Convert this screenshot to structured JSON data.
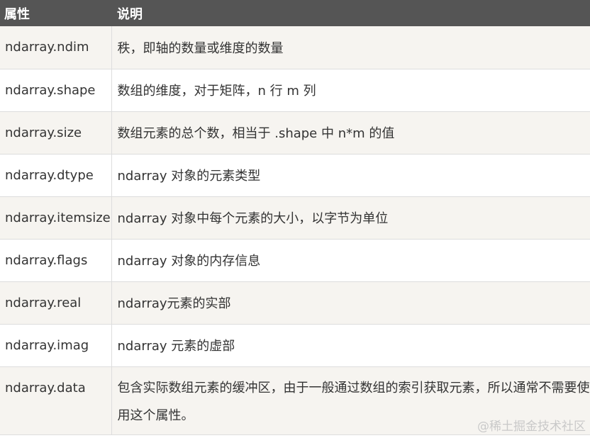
{
  "header": {
    "col_attribute": "属性",
    "col_description": "说明"
  },
  "rows": [
    {
      "attribute": "ndarray.ndim",
      "description": "秩，即轴的数量或维度的数量"
    },
    {
      "attribute": "ndarray.shape",
      "description": "数组的维度，对于矩阵，n 行 m 列"
    },
    {
      "attribute": "ndarray.size",
      "description": "数组元素的总个数，相当于 .shape 中 n*m 的值"
    },
    {
      "attribute": "ndarray.dtype",
      "description": "ndarray 对象的元素类型"
    },
    {
      "attribute": "ndarray.itemsize",
      "description": "ndarray 对象中每个元素的大小，以字节为单位"
    },
    {
      "attribute": "ndarray.flags",
      "description": "ndarray 对象的内存信息"
    },
    {
      "attribute": "ndarray.real",
      "description": "ndarray元素的实部"
    },
    {
      "attribute": "ndarray.imag",
      "description": "ndarray 元素的虚部"
    },
    {
      "attribute": "ndarray.data",
      "description": "包含实际数组元素的缓冲区，由于一般通过数组的索引获取元素，所以通常不需要使用这个属性。"
    }
  ],
  "watermark": "@稀土掘金技术社区",
  "colors": {
    "header_bg": "#555555",
    "header_text": "#ffffff",
    "row_alt_bg": "#f6f4f0",
    "row_bg": "#ffffff",
    "border": "#dddddd"
  }
}
